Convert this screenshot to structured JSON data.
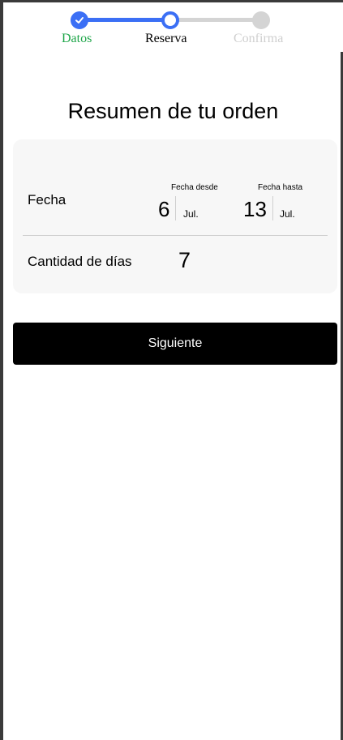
{
  "stepper": {
    "steps": [
      {
        "label": "Datos",
        "state": "complete"
      },
      {
        "label": "Reserva",
        "state": "current"
      },
      {
        "label": "Confirma",
        "state": "pending"
      }
    ],
    "colors": {
      "active": "#3b6ff5",
      "complete_label": "#1fa64a",
      "pending": "#d4d4d4"
    }
  },
  "page": {
    "title": "Resumen de tu orden"
  },
  "summary": {
    "fecha_label": "Fecha",
    "desde": {
      "label": "Fecha desde",
      "day": "6",
      "month": "Jul."
    },
    "hasta": {
      "label": "Fecha hasta",
      "day": "13",
      "month": "Jul."
    },
    "dias_label": "Cantidad de días",
    "dias_value": "7"
  },
  "actions": {
    "next_label": "Siguiente"
  },
  "icons": {
    "step_complete": "check-icon"
  }
}
